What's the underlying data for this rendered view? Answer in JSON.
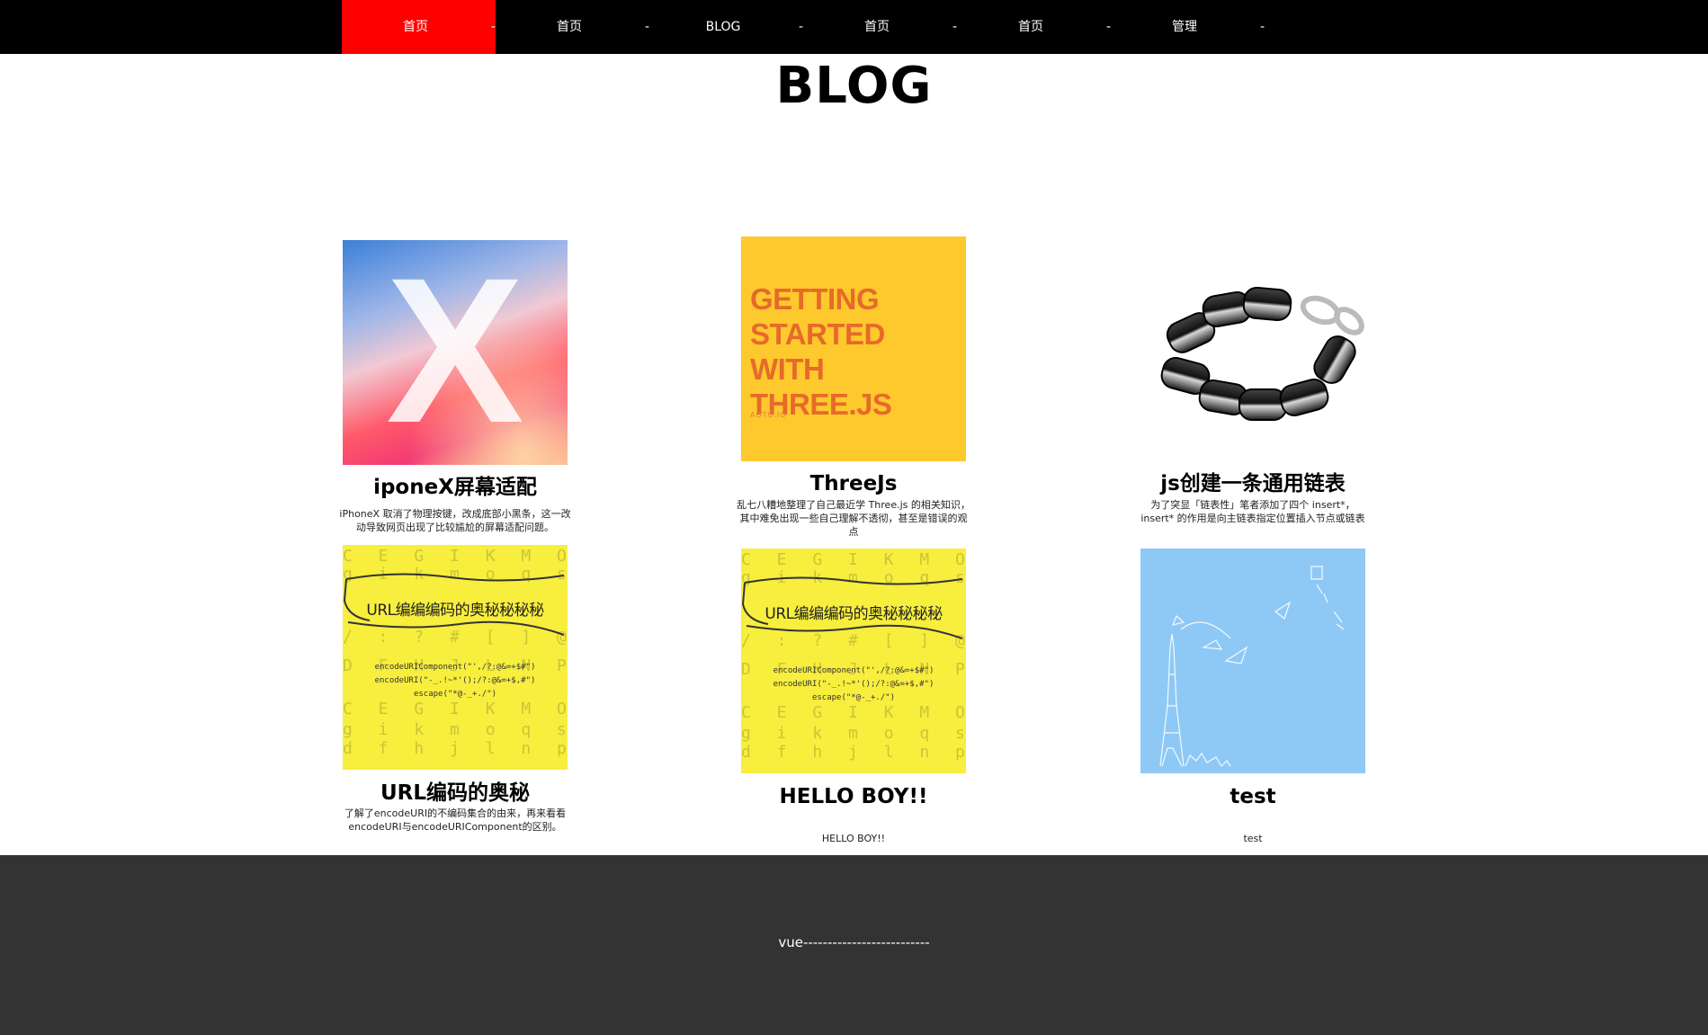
{
  "nav": {
    "items": [
      {
        "label": "首页",
        "sep": "-"
      },
      {
        "label": "首页",
        "sep": "-"
      },
      {
        "label": "BLOG",
        "sep": "-"
      },
      {
        "label": "首页",
        "sep": "-"
      },
      {
        "label": "首页",
        "sep": "-"
      },
      {
        "label": "管理",
        "sep": "-"
      }
    ],
    "active_color": "#ff0000"
  },
  "page_title": "BLOG",
  "posts": [
    {
      "title": "iponeX屏幕适配",
      "desc": "iPhoneX 取消了物理按键，改成底部小黑条，这一改动导致网页出现了比较尴尬的屏幕适配问题。",
      "image": {
        "big_letter": "X"
      }
    },
    {
      "title": "ThreeJs",
      "desc": "乱七八糟地整理了自己最近学 Three.js 的相关知识，其中难免出现一些自己理解不透彻，甚至是错误的观点",
      "image": {
        "headline": "GETTING STARTED WITH THREE.JS",
        "subtitle": "AOTU.IO"
      }
    },
    {
      "title": "js创建一条通用链表",
      "desc": "为了突显「链表性」笔者添加了四个 insert*，insert* 的作用是向主链表指定位置插入节点或链表",
      "image": {}
    },
    {
      "title": "URL编码的奥秘",
      "desc": "了解了encodeURI的不编码集合的由来，再来看看encodeURI与encodeURIComponent的区别。",
      "image": {
        "headline": "URL编编编码的奥秘秘秘秘",
        "code": [
          "encodeURIComponent(\"',/?:@&=+$#\")",
          "encodeURI(\"-_.!~*'();/?:@&=+$,#\")",
          "escape(\"*@-_+./\")"
        ],
        "bg_rows": [
          "C E G I K M O Q S U W",
          "g i k m o q s u w y 1 3 5",
          "/ : ? # [ ] @ ! $ & ' ( ) * +",
          "D F H J L N P R T V X",
          "C E G I K M O Q S U W",
          "g i k m o q s u w y 1 3 5 7",
          "d f h j l n p r t v x z 2 4 6",
          "= : / ? # [ ] @ ! $ & ' ( ) * +"
        ]
      }
    },
    {
      "title": "HELLO BOY!!",
      "desc": "HELLO BOY!!",
      "image": {
        "headline": "URL编编编码的奥秘秘秘秘",
        "code": [
          "encodeURIComponent(\"',/?:@&=+$#\")",
          "encodeURI(\"-_.!~*'();/?:@&=+$,#\")",
          "escape(\"*@-_+./\")"
        ],
        "bg_rows": [
          "C E G I K M O Q S U W",
          "g i k m o q s u w y 1 3 5",
          "/ : ? # [ ] @ ! $ & ' ( ) * +",
          "D F H J L N P R T V X",
          "C E G I K M O Q S U W",
          "g i k m o q s u w y 1 3 5 7",
          "d f h j l n p r t v x z 2 4 6",
          "= : / ? # [ ] @ ! $ & ' ( ) * +"
        ]
      }
    },
    {
      "title": "test",
      "desc": "test",
      "image": {}
    }
  ],
  "footer": {
    "text": "vue--------------------------"
  },
  "colors": {
    "nav_bg": "#000000",
    "footer_bg": "#333333",
    "three_bg": "#fdc92d",
    "url_bg": "#f7ee3e",
    "test_bg": "#8ec9f5"
  }
}
